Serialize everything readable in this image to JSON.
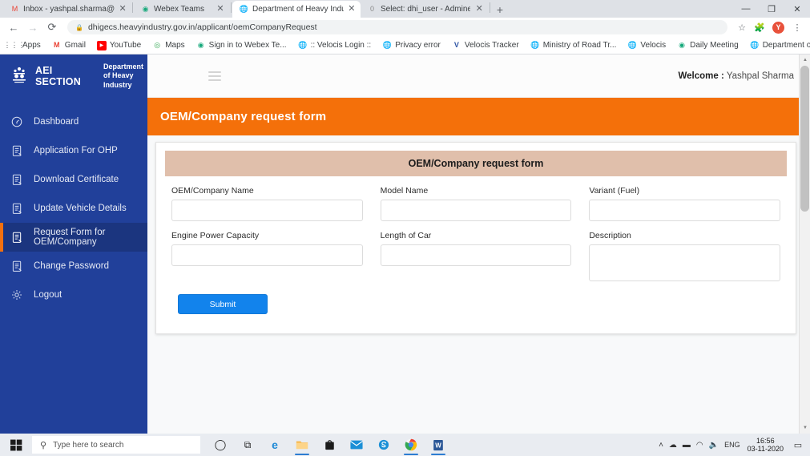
{
  "browser": {
    "tabs": [
      {
        "title": "Inbox - yashpal.sharma@veloci",
        "favicon": "gmail-icon",
        "active": false
      },
      {
        "title": "Webex Teams",
        "favicon": "webex-icon",
        "active": false
      },
      {
        "title": "Department of Heavy Industry",
        "favicon": "globe-icon",
        "active": true
      },
      {
        "title": "Select: dhi_user - Adminer",
        "favicon": "adminer-icon",
        "active": false
      }
    ],
    "new_tab_label": "+",
    "window_controls": {
      "minimize": "—",
      "maximize": "❐",
      "close": "✕"
    },
    "nav": {
      "back": "←",
      "forward": "→",
      "reload": "⟳"
    },
    "omnibox": {
      "url": "dhigecs.heavyindustry.gov.in/applicant/oemCompanyRequest",
      "lock": "🔒"
    },
    "toolbar_icons": {
      "bookmark_star": "☆",
      "extensions": "🧩",
      "menu": "⋮"
    },
    "profile_initial": "Y",
    "bookmarks": [
      {
        "label": "Apps",
        "icon": "apps-grid-icon"
      },
      {
        "label": "Gmail",
        "icon": "gmail-icon"
      },
      {
        "label": "YouTube",
        "icon": "youtube-icon"
      },
      {
        "label": "Maps",
        "icon": "maps-icon"
      },
      {
        "label": "Sign in to Webex Te...",
        "icon": "webex-icon"
      },
      {
        "label": ":: Velocis Login ::",
        "icon": "globe-icon"
      },
      {
        "label": "Privacy error",
        "icon": "globe-icon"
      },
      {
        "label": "Velocis Tracker",
        "icon": "velocis-v-icon"
      },
      {
        "label": "Ministry of Road Tr...",
        "icon": "globe-icon"
      },
      {
        "label": "Velocis",
        "icon": "globe-icon"
      },
      {
        "label": "Daily Meeting",
        "icon": "webex-icon"
      },
      {
        "label": "Department of Hea...",
        "icon": "globe-icon"
      }
    ]
  },
  "sidebar": {
    "brand": {
      "title": "AEI SECTION",
      "subtitle": "Department of Heavy Industry",
      "emblem": "india-emblem-icon"
    },
    "items": [
      {
        "label": "Dashboard",
        "icon": "dashboard-icon",
        "active": false
      },
      {
        "label": "Application For OHP",
        "icon": "document-icon",
        "active": false
      },
      {
        "label": "Download Certificate",
        "icon": "document-icon",
        "active": false
      },
      {
        "label": "Update Vehicle Details",
        "icon": "document-icon",
        "active": false
      },
      {
        "label": "Request Form for OEM/Company",
        "icon": "document-icon",
        "active": true
      },
      {
        "label": "Change Password",
        "icon": "document-icon",
        "active": false
      },
      {
        "label": "Logout",
        "icon": "gear-icon",
        "active": false
      }
    ]
  },
  "header": {
    "menu_toggle": "hamburger-icon",
    "welcome_label": "Welcome :",
    "user_name": "Yashpal Sharma"
  },
  "page": {
    "banner_title": "OEM/Company request form",
    "card_title": "OEM/Company request form"
  },
  "form": {
    "fields": [
      {
        "label": "OEM/Company Name",
        "value": "",
        "placeholder": "",
        "type": "text"
      },
      {
        "label": "Model Name",
        "value": "",
        "placeholder": "",
        "type": "text"
      },
      {
        "label": "Variant (Fuel)",
        "value": "",
        "placeholder": "",
        "type": "text"
      },
      {
        "label": "Engine Power Capacity",
        "value": "",
        "placeholder": "",
        "type": "text"
      },
      {
        "label": "Length of Car",
        "value": "",
        "placeholder": "",
        "type": "text"
      },
      {
        "label": "Description",
        "value": "",
        "placeholder": "",
        "type": "textarea"
      }
    ],
    "submit_label": "Submit"
  },
  "taskbar": {
    "start": "windows-start-icon",
    "search_placeholder": "Type here to search",
    "apps": [
      {
        "name": "cortana-icon",
        "glyph": "○",
        "open": false
      },
      {
        "name": "task-view-icon",
        "glyph": "⧉",
        "open": false
      },
      {
        "name": "edge-icon",
        "glyph": "e",
        "open": false
      },
      {
        "name": "file-explorer-icon",
        "glyph": "🗀",
        "open": true
      },
      {
        "name": "microsoft-store-icon",
        "glyph": "🛍",
        "open": false
      },
      {
        "name": "mail-icon",
        "glyph": "✉",
        "open": false
      },
      {
        "name": "skype-icon",
        "glyph": "Ⓢ",
        "open": false
      },
      {
        "name": "chrome-icon",
        "glyph": "◉",
        "open": true
      },
      {
        "name": "word-icon",
        "glyph": "W",
        "open": true
      }
    ],
    "tray": {
      "chevron": "˄",
      "icons": [
        {
          "name": "onedrive-icon",
          "glyph": "☁"
        },
        {
          "name": "battery-icon",
          "glyph": "▬"
        },
        {
          "name": "wifi-icon",
          "glyph": "◠"
        },
        {
          "name": "volume-icon",
          "glyph": "🔊"
        }
      ],
      "language": "ENG",
      "time": "16:56",
      "date": "03-11-2020",
      "notifications": "▭"
    }
  },
  "colors": {
    "sidebar_bg": "#21409a",
    "sidebar_active_bg": "#1b357f",
    "accent_orange": "#f4700a",
    "card_head_bg": "#e0bfab",
    "submit_blue": "#1283ec"
  }
}
